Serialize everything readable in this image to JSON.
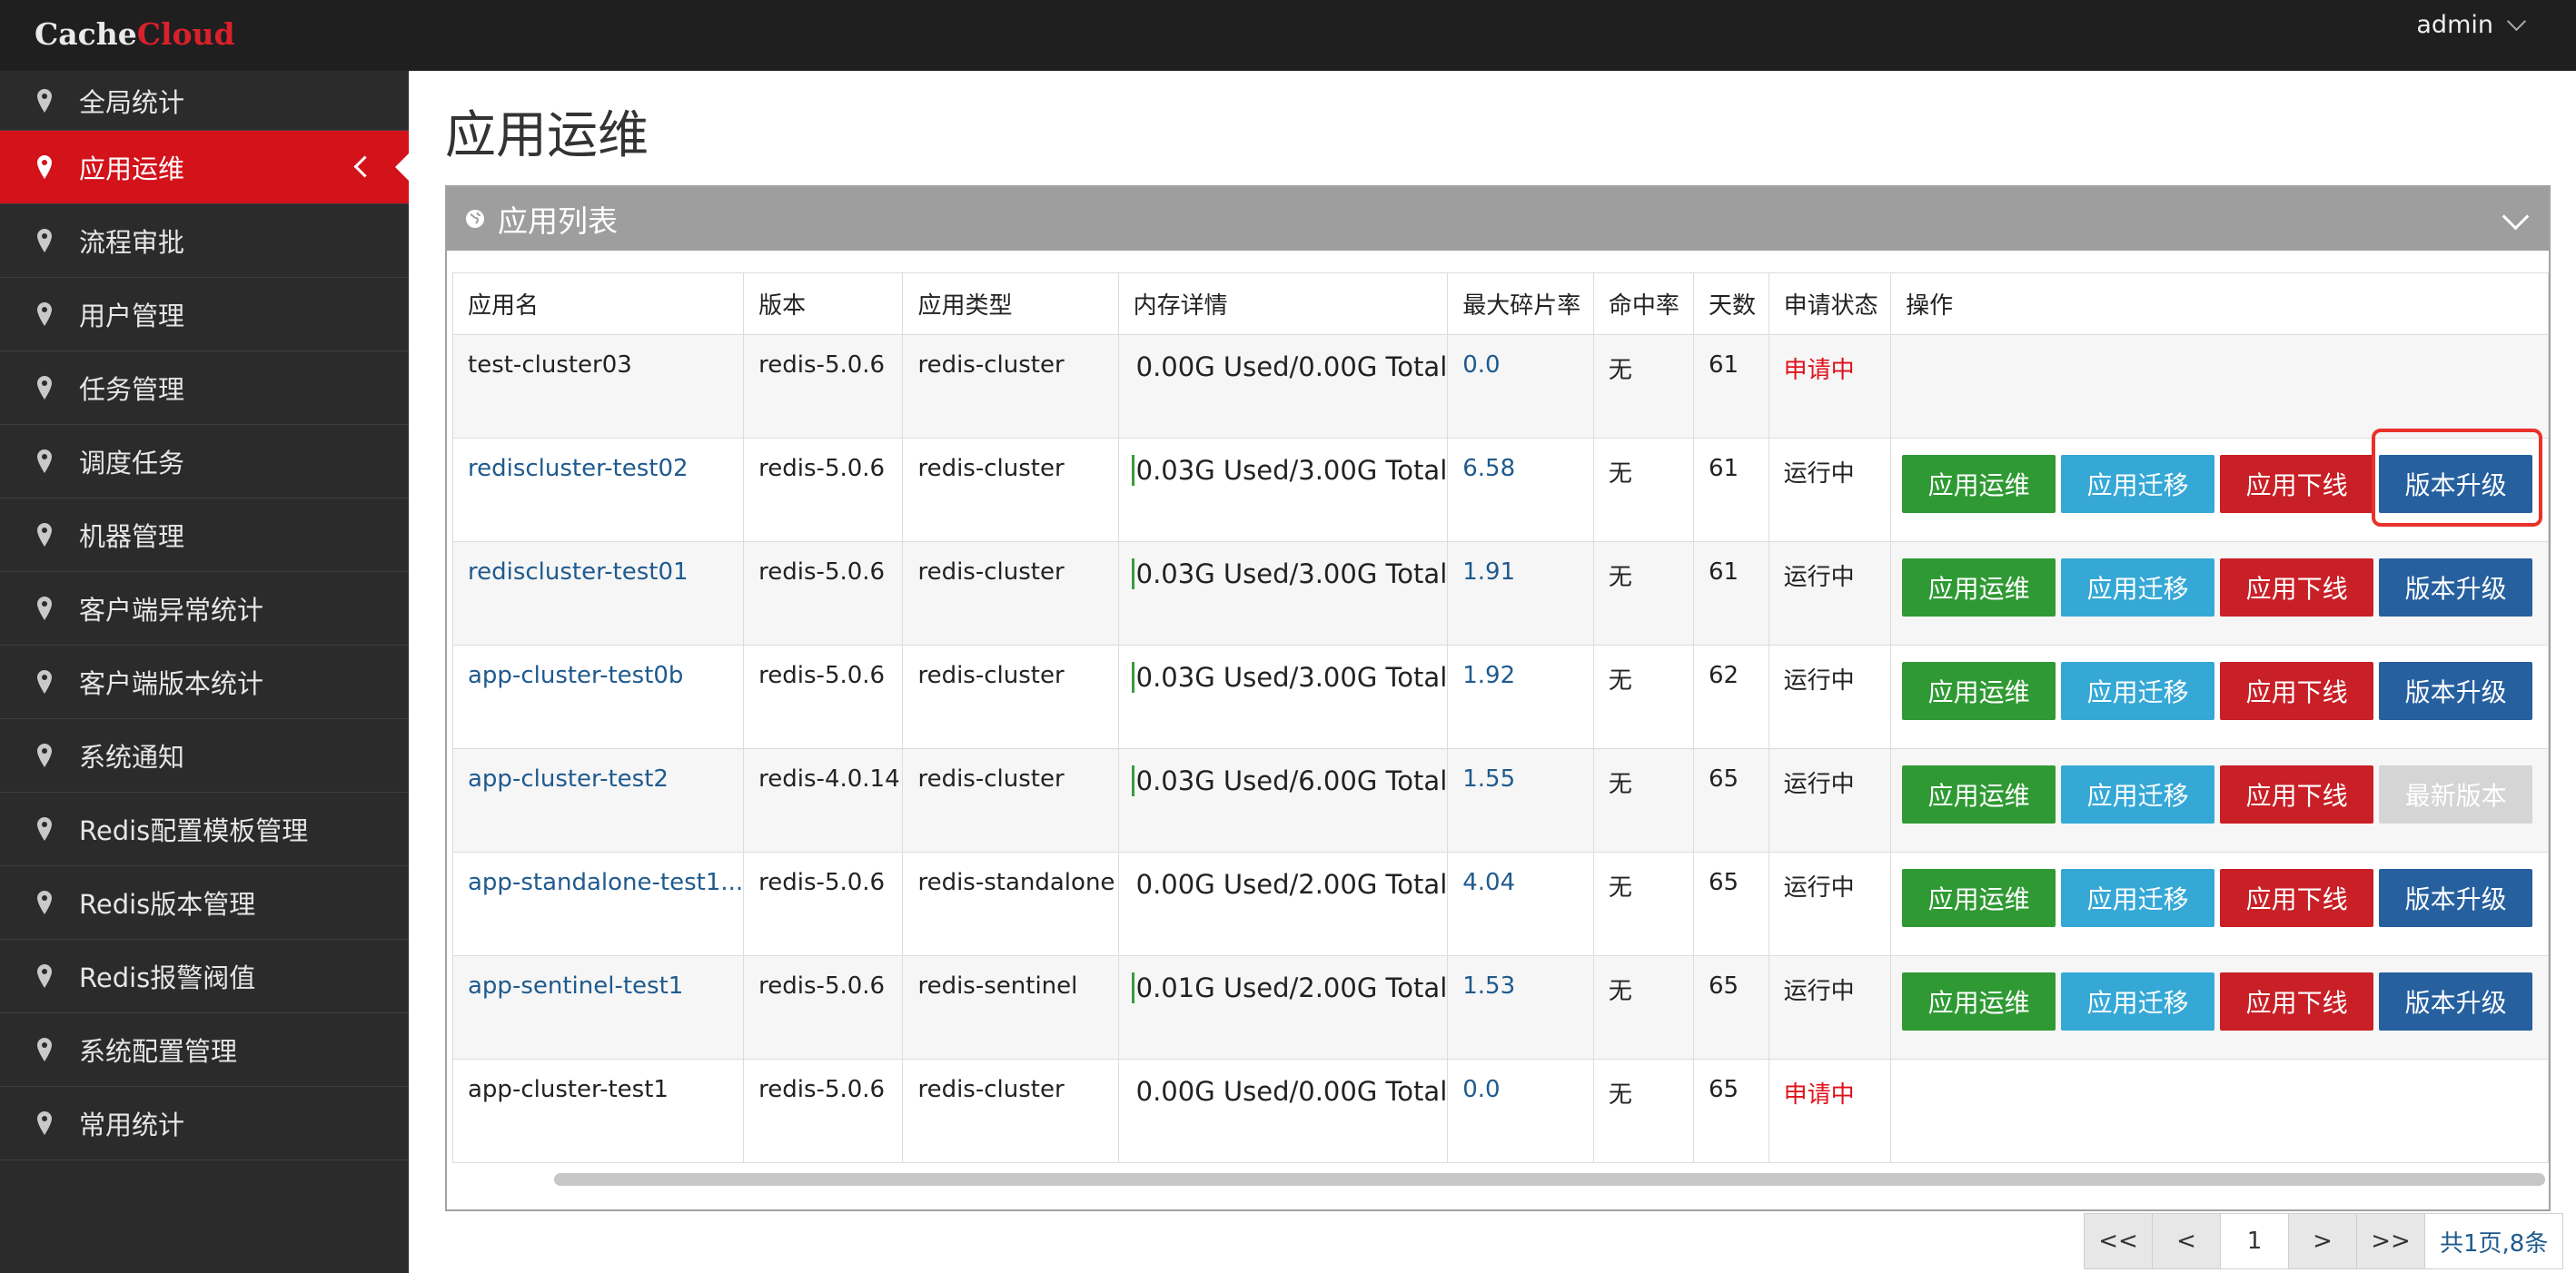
{
  "brand": {
    "part1": "Cache",
    "part2": "Cloud"
  },
  "user": {
    "name": "admin"
  },
  "sidebar": {
    "items": [
      {
        "label": "全局统计"
      },
      {
        "label": "应用运维",
        "active": true
      },
      {
        "label": "流程审批"
      },
      {
        "label": "用户管理"
      },
      {
        "label": "任务管理"
      },
      {
        "label": "调度任务"
      },
      {
        "label": "机器管理"
      },
      {
        "label": "客户端异常统计"
      },
      {
        "label": "客户端版本统计"
      },
      {
        "label": "系统通知"
      },
      {
        "label": "Redis配置模板管理"
      },
      {
        "label": "Redis版本管理"
      },
      {
        "label": "Redis报警阀值"
      },
      {
        "label": "系统配置管理"
      },
      {
        "label": "常用统计"
      }
    ]
  },
  "page": {
    "title": "应用运维"
  },
  "panel": {
    "title": "应用列表"
  },
  "table": {
    "headers": [
      "应用名",
      "版本",
      "应用类型",
      "内存详情",
      "最大碎片率",
      "命中率",
      "天数",
      "申请状态",
      "操作"
    ],
    "rows": [
      {
        "name": "test-cluster03",
        "version": "redis-5.0.6",
        "type": "redis-cluster",
        "memory": "0.00G  Used/0.00G  Total",
        "frag": "0.0",
        "hit": "无",
        "days": "61",
        "state": "申请中"
      },
      {
        "name": "rediscluster-test02",
        "version": "redis-5.0.6",
        "type": "redis-cluster",
        "memory": "0.03G  Used/3.00G  Total",
        "frag": "6.58",
        "hit": "无",
        "days": "61",
        "state": "运行中"
      },
      {
        "name": "rediscluster-test01",
        "version": "redis-5.0.6",
        "type": "redis-cluster",
        "memory": "0.03G  Used/3.00G  Total",
        "frag": "1.91",
        "hit": "无",
        "days": "61",
        "state": "运行中"
      },
      {
        "name": "app-cluster-test0b",
        "version": "redis-5.0.6",
        "type": "redis-cluster",
        "memory": "0.03G  Used/3.00G  Total",
        "frag": "1.92",
        "hit": "无",
        "days": "62",
        "state": "运行中"
      },
      {
        "name": "app-cluster-test2",
        "version": "redis-4.0.14",
        "type": "redis-cluster",
        "memory": "0.03G  Used/6.00G  Total",
        "frag": "1.55",
        "hit": "无",
        "days": "65",
        "state": "运行中"
      },
      {
        "name": "app-standalone-test1...",
        "version": "redis-5.0.6",
        "type": "redis-standalone",
        "memory": "0.00G  Used/2.00G  Total",
        "frag": "4.04",
        "hit": "无",
        "days": "65",
        "state": "运行中"
      },
      {
        "name": "app-sentinel-test1",
        "version": "redis-5.0.6",
        "type": "redis-sentinel",
        "memory": "0.01G  Used/2.00G  Total",
        "frag": "1.53",
        "hit": "无",
        "days": "65",
        "state": "运行中"
      },
      {
        "name": "app-cluster-test1",
        "version": "redis-5.0.6",
        "type": "redis-cluster",
        "memory": "0.00G  Used/0.00G  Total",
        "frag": "0.0",
        "hit": "无",
        "days": "65",
        "state": "申请中"
      }
    ]
  },
  "buttons": {
    "ops": "应用运维",
    "migrate": "应用迁移",
    "offline": "应用下线",
    "upgrade": "版本升级",
    "latest": "最新版本"
  },
  "pager": {
    "first": "<<",
    "prev": "<",
    "page": "1",
    "next": ">",
    "last": ">>",
    "summary": "共1页,8条"
  },
  "colors": {
    "accent": "#d3121a",
    "ops_btn": "#2f9a34",
    "migrate_btn": "#35a8d6",
    "offline_btn": "#c91f26",
    "upgrade_btn": "#26609f"
  }
}
